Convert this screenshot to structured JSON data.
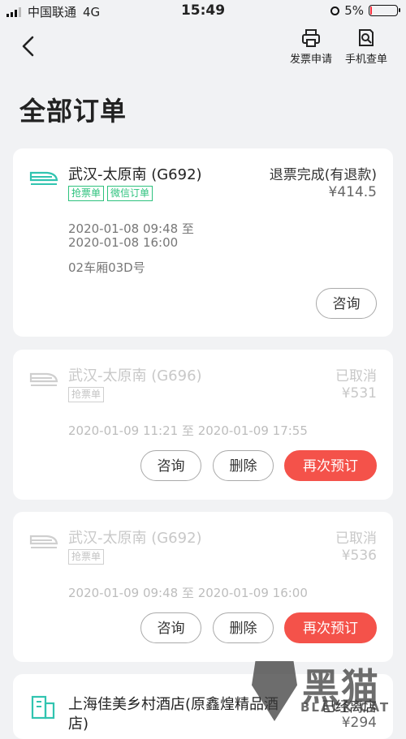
{
  "status_bar": {
    "carrier": "中国联通",
    "network": "4G",
    "time": "15:49",
    "battery_pct": "5%",
    "battery_level": 0.05,
    "accent": "#ff2d3b"
  },
  "nav": {
    "invoice_label": "发票申请",
    "phone_lookup_label": "手机查单"
  },
  "page_title": "全部订单",
  "orders": [
    {
      "route": "武汉-太原南 (G692)",
      "status": "退票完成(有退款)",
      "price": "¥414.5",
      "tags": [
        "抢票单",
        "微信订单"
      ],
      "time_start": "2020-01-08 09:48 至",
      "time_end": "2020-01-08 16:00",
      "seat": "02车厢03D号",
      "consult_label": "咨询"
    },
    {
      "route": "武汉-太原南 (G696)",
      "status": "已取消",
      "price": "¥531",
      "tags": [
        "抢票单"
      ],
      "time": "2020-01-09 11:21 至 2020-01-09 17:55",
      "consult_label": "咨询",
      "delete_label": "删除",
      "rebook_label": "再次预订"
    },
    {
      "route": "武汉-太原南 (G692)",
      "status": "已取消",
      "price": "¥536",
      "tags": [
        "抢票单"
      ],
      "time": "2020-01-09 09:48 至 2020-01-09 16:00",
      "consult_label": "咨询",
      "delete_label": "删除",
      "rebook_label": "再次预订"
    },
    {
      "name": "上海佳美乡村酒店(原鑫煌精品酒店)",
      "status": "已经离店",
      "price": "¥294"
    }
  ],
  "watermark": {
    "glyph": "黑猫",
    "text": "BLACK CAT"
  },
  "colors": {
    "accent_red": "#f4524a",
    "tag_green": "#2ec27e",
    "train_teal": "#31c4b0"
  }
}
